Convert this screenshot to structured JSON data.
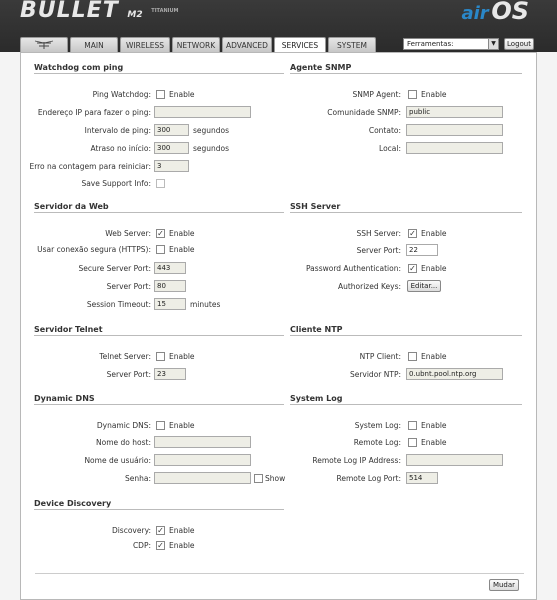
{
  "header": {
    "brand": "BULLET",
    "brand_suffix": "M2",
    "brand_tiny": "TITANIUM",
    "right_logo_a": "air",
    "right_logo_b": "OS"
  },
  "tabs": [
    {
      "label": "MAIN"
    },
    {
      "label": "WIRELESS"
    },
    {
      "label": "NETWORK"
    },
    {
      "label": "ADVANCED"
    },
    {
      "label": "SERVICES",
      "active": true
    },
    {
      "label": "SYSTEM"
    }
  ],
  "tools": {
    "selected": "Ferramentas:",
    "logout": "Logout"
  },
  "watchdog": {
    "title": "Watchdog com ping",
    "ping_label": "Ping Watchdog:",
    "ping_enable": "Enable",
    "ip_label": "Endereço IP para fazer o ping:",
    "ip_value": "",
    "interval_label": "Intervalo de ping:",
    "interval_value": "300",
    "interval_unit": "segundos",
    "delay_label": "Atraso no início:",
    "delay_value": "300",
    "delay_unit": "segundos",
    "errors_label": "Erro na contagem para reiniciar:",
    "errors_value": "3",
    "support_label": "Save Support Info:"
  },
  "snmp": {
    "title": "Agente SNMP",
    "agent_label": "SNMP Agent:",
    "agent_enable": "Enable",
    "community_label": "Comunidade SNMP:",
    "community_value": "public",
    "contact_label": "Contato:",
    "contact_value": "",
    "location_label": "Local:",
    "location_value": ""
  },
  "web": {
    "title": "Servidor da Web",
    "server_label": "Web Server:",
    "server_enable": "Enable",
    "https_label": "Usar conexão segura (HTTPS):",
    "https_enable": "Enable",
    "secure_port_label": "Secure Server Port:",
    "secure_port_value": "443",
    "port_label": "Server Port:",
    "port_value": "80",
    "timeout_label": "Session Timeout:",
    "timeout_value": "15",
    "timeout_unit": "minutes"
  },
  "ssh": {
    "title": "SSH Server",
    "server_label": "SSH Server:",
    "server_enable": "Enable",
    "port_label": "Server Port:",
    "port_value": "22",
    "pwauth_label": "Password Authentication:",
    "pwauth_enable": "Enable",
    "keys_label": "Authorized Keys:",
    "keys_button": "Editar..."
  },
  "telnet": {
    "title": "Servidor Telnet",
    "server_label": "Telnet Server:",
    "server_enable": "Enable",
    "port_label": "Server Port:",
    "port_value": "23"
  },
  "ntp": {
    "title": "Cliente NTP",
    "client_label": "NTP Client:",
    "client_enable": "Enable",
    "server_label": "Servidor NTP:",
    "server_value": "0.ubnt.pool.ntp.org"
  },
  "ddns": {
    "title": "Dynamic DNS",
    "ddns_label": "Dynamic DNS:",
    "ddns_enable": "Enable",
    "host_label": "Nome do host:",
    "host_value": "",
    "user_label": "Nome de usuário:",
    "user_value": "",
    "pass_label": "Senha:",
    "pass_value": "",
    "show_label": "Show"
  },
  "syslog": {
    "title": "System Log",
    "syslog_label": "System Log:",
    "syslog_enable": "Enable",
    "remote_label": "Remote Log:",
    "remote_enable": "Enable",
    "remote_ip_label": "Remote Log IP Address:",
    "remote_ip_value": "",
    "remote_port_label": "Remote Log Port:",
    "remote_port_value": "514"
  },
  "discovery": {
    "title": "Device Discovery",
    "discovery_label": "Discovery:",
    "discovery_enable": "Enable",
    "cdp_label": "CDP:",
    "cdp_enable": "Enable"
  },
  "footer": {
    "change_button": "Mudar"
  }
}
